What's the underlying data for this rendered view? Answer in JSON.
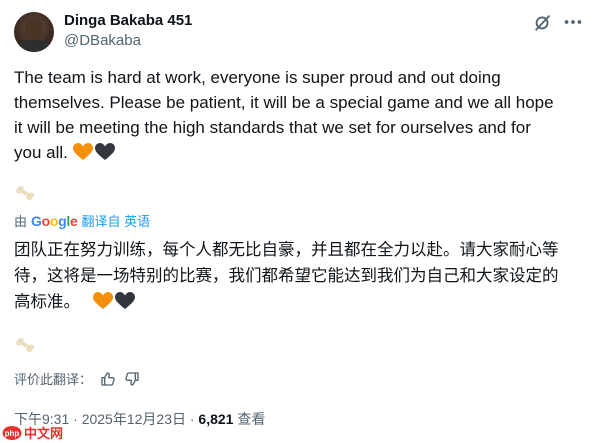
{
  "user": {
    "display_name": "Dinga Bakaba 451",
    "handle": "@DBakaba"
  },
  "tweet": {
    "lines": [
      "The team is hard at work, everyone is super proud and out doing",
      "themselves.  Please be patient, it will be a special game and we all hope",
      "it will be meeting the high standards that we set for ourselves and for",
      "you all."
    ],
    "emojis": [
      "orange-heart",
      "black-heart"
    ]
  },
  "translation": {
    "prefix": "由",
    "provider": "Google",
    "link": "翻译自 英语",
    "lines": [
      "团队正在努力训练，每个人都无比自豪，并且都在全力以赴。请大家耐心等",
      "待，这将是一场特别的比赛，我们都希望它能达到我们为自己和大家设定的",
      "高标准。"
    ]
  },
  "rate": {
    "label": "评价此翻译："
  },
  "meta": {
    "time": "下午9:31 · 2025年12月23日 · ",
    "views_count": "6,821",
    "views_label": " 查看"
  },
  "watermark": {
    "text": "中文网",
    "brand": "php"
  },
  "colors": {
    "link_blue": "#1d9bf0",
    "secondary_text": "#536471",
    "orange_heart": "#f4900c",
    "black_heart": "#31373d"
  }
}
